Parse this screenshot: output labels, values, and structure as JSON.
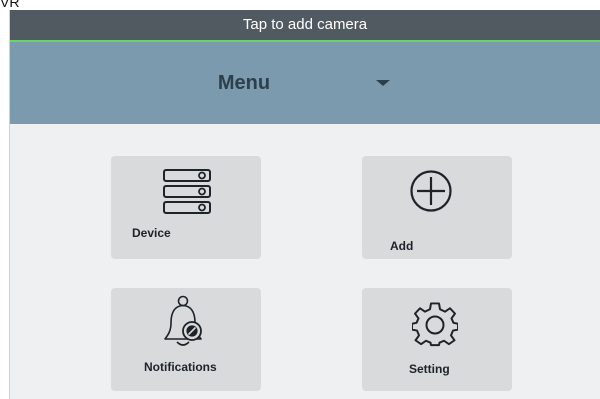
{
  "top_fragment": "VR",
  "status_bar": {
    "text": "Tap to add camera"
  },
  "menu_bar": {
    "title": "Menu"
  },
  "tiles": [
    {
      "label": "Device",
      "icon": "server-stack-icon"
    },
    {
      "label": "Add",
      "icon": "plus-circle-icon"
    },
    {
      "label": "Notifications",
      "icon": "bell-icon"
    },
    {
      "label": "Setting",
      "icon": "gear-icon"
    }
  ],
  "colors": {
    "status_bar_bg": "#515a61",
    "status_bar_accent": "#66d46a",
    "menu_bar_bg": "#7c9aae",
    "content_bg": "#eef0f1",
    "tile_bg": "#d8dadc"
  }
}
